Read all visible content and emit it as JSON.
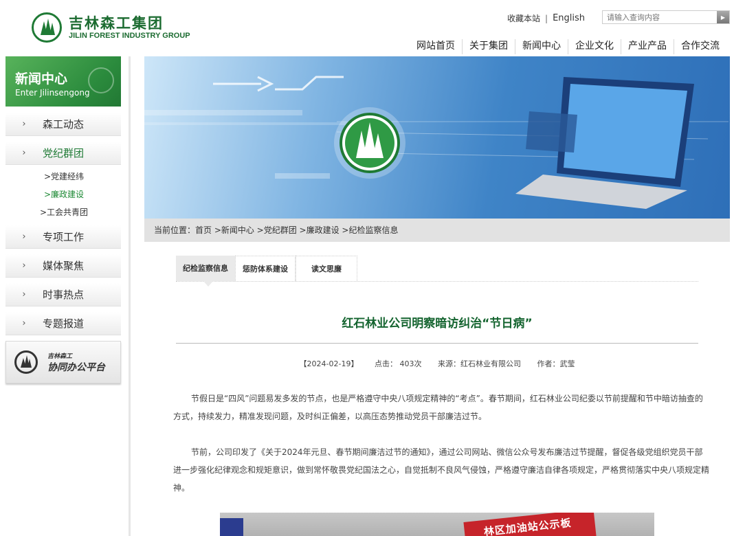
{
  "header": {
    "logo_cn": "吉林森工集团",
    "logo_en": "JILIN FOREST INDUSTRY GROUP",
    "favorite": "收藏本站",
    "separator": "|",
    "english": "English",
    "search_placeholder": "请输入查询内容",
    "search_icon": "play-arrow-icon"
  },
  "nav": {
    "items": [
      "网站首页",
      "关于集团",
      "新闻中心",
      "企业文化",
      "产业产品",
      "合作交流"
    ]
  },
  "sidebar": {
    "head_title": "新闻中心",
    "head_sub": "Enter Jilinsengong",
    "arrow": "›",
    "items": [
      "森工动态",
      "党纪群团",
      "专项工作",
      "媒体聚焦",
      "时事热点",
      "专题报道"
    ],
    "sub_items": [
      ">党建经纬",
      ">廉政建设",
      ">工会共青团"
    ],
    "oa_small": "吉林森工",
    "oa_big": "协同办公平台"
  },
  "breadcrumb": "当前位置：首页 >新闻中心 >党纪群团 >廉政建设 >纪检监察信息",
  "tabs": [
    "纪检监察信息",
    "惩防体系建设",
    "读文思廉"
  ],
  "article": {
    "title": "红石林业公司明察暗访纠治“节日病”",
    "date": "【2024-02-19】",
    "views": "点击：  403次",
    "source": "来源：红石林业有限公司",
    "author": "作者：武莹",
    "p1": "节假日是“四风”问题易发多发的节点，也是严格遵守中央八项规定精神的“考点”。春节期间，红石林业公司纪委以节前提醒和节中暗访抽查的方式，持续发力，精准发现问题，及时纠正偏差，以高压态势推动党员干部廉洁过节。",
    "p2": "节前，公司印发了《关于2024年元旦、春节期间廉洁过节的通知》，通过公司网站、微信公众号发布廉洁过节提醒，督促各级党组织党员干部进一步强化纪律观念和规矩意识，做到常怀敬畏党纪国法之心，自觉抵制不良风气侵蚀，严格遵守廉洁自律各项规定，严格贯彻落实中央八项规定精神。",
    "photo_banner": "林区加油站公示板"
  },
  "colors": {
    "brand_green": "#1f7a35",
    "title_green": "#14642f",
    "crumb_bg": "#e2e2e2"
  }
}
